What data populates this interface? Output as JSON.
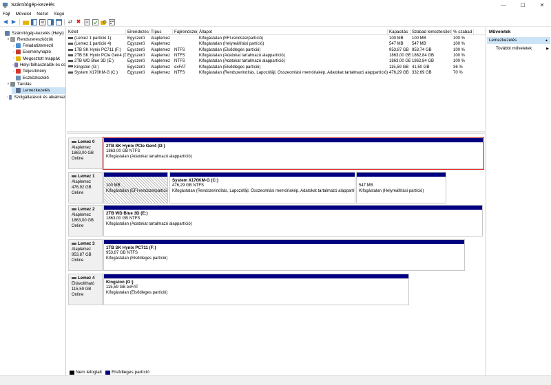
{
  "window": {
    "title": "Számítógép-kezelés"
  },
  "menu": [
    "Fájl",
    "Művelet",
    "Nézet",
    "Súgó"
  ],
  "tree": [
    {
      "label": "Számítógép-kezelés (Helyi)",
      "level": 0,
      "expander": "",
      "icon": "computer-icon",
      "color": "#5b7fa6"
    },
    {
      "label": "Rendszereszközök",
      "level": 1,
      "expander": "v",
      "icon": "tools-icon",
      "color": "#9a9a9a"
    },
    {
      "label": "Feladatütemező",
      "level": 2,
      "expander": ">",
      "icon": "clock-icon",
      "color": "#4a8fd0"
    },
    {
      "label": "Eseménynapló",
      "level": 2,
      "expander": ">",
      "icon": "event-log-icon",
      "color": "#c0392b"
    },
    {
      "label": "Megosztott mappák",
      "level": 2,
      "expander": ">",
      "icon": "folder-icon",
      "color": "#e6b400"
    },
    {
      "label": "Helyi felhasználók és cs",
      "level": 2,
      "expander": ">",
      "icon": "users-icon",
      "color": "#7a6fb3"
    },
    {
      "label": "Teljesítmény",
      "level": 2,
      "expander": ">",
      "icon": "performance-icon",
      "color": "#d9342b"
    },
    {
      "label": "Eszközkezelő",
      "level": 2,
      "expander": "",
      "icon": "device-icon",
      "color": "#6b8fb3"
    },
    {
      "label": "Tárolás",
      "level": 1,
      "expander": "v",
      "icon": "storage-icon",
      "color": "#7f8c8d"
    },
    {
      "label": "Lemezkezelés",
      "level": 2,
      "expander": "",
      "icon": "disk-icon",
      "color": "#5a6e8c",
      "selected": true
    },
    {
      "label": "Szolgáltatások és alkalmaz",
      "level": 1,
      "expander": ">",
      "icon": "services-icon",
      "color": "#6c8ebf"
    }
  ],
  "volume_table": {
    "columns": [
      "Kötet",
      "Elrendezés",
      "Típus",
      "Fájlrendszer",
      "Állapot",
      "Kapacitás",
      "Szabad lemezterület",
      "% szabad"
    ],
    "rows": [
      [
        "(Lemez 1 partíció 1)",
        "Egyszerű",
        "Alaplemez",
        "",
        "Kifogástalan (EFI-rendszerpartíció)",
        "100 MB",
        "100 MB",
        "100 %"
      ],
      [
        "(Lemez 1 partíció 4)",
        "Egyszerű",
        "Alaplemez",
        "",
        "Kifogástalan (Helyreállítási partíció)",
        "547 MB",
        "547 MB",
        "100 %"
      ],
      [
        "1TB SK Hynix PC711 (F:)",
        "Egyszerű",
        "Alaplemez",
        "NTFS",
        "Kifogástalan (Elsődleges partíció)",
        "953,87 GB",
        "953,74 GB",
        "100 %"
      ],
      [
        "2TB SK Hynix PCIe Gen4 (D:)",
        "Egyszerű",
        "Alaplemez",
        "NTFS",
        "Kifogástalan (Adatokat tartalmazó alappartíció)",
        "1863,00 GB",
        "1862,84 GB",
        "100 %"
      ],
      [
        "2TB WD Blue 3D (E:)",
        "Egyszerű",
        "Alaplemez",
        "NTFS",
        "Kifogástalan (Adatokat tartalmazó alappartíció)",
        "1863,00 GB",
        "1862,84 GB",
        "100 %"
      ],
      [
        "Kingston (G:)",
        "Egyszerű",
        "Alaplemez",
        "exFAT",
        "Kifogástalan (Elsődleges partíció)",
        "115,59 GB",
        "41,50 GB",
        "36 %"
      ],
      [
        "System X170KM-G (C:)",
        "Egyszerű",
        "Alaplemez",
        "NTFS",
        "Kifogástalan (Rendszerindítás, Lapozófájl, Összeomlási memóriakép, Adatokat tartalmazó alappartíció)",
        "476,29 GB",
        "332,69 GB",
        "70 %"
      ]
    ]
  },
  "disks": [
    {
      "name": "Lemez 0",
      "type": "Alaplemez",
      "size": "1863,00 GB",
      "status": "Online",
      "partitions": [
        {
          "name": "2TB SK Hynix PCIe Gen4  (D:)",
          "size": "1863,00 GB NTFS",
          "status": "Kifogástalan (Adatokat tartalmazó alappartíció)",
          "selected": true
        }
      ]
    },
    {
      "name": "Lemez 1",
      "type": "Alaplemez",
      "size": "476,92 GB",
      "status": "Online",
      "partitions": [
        {
          "name": "",
          "size": "100 MB",
          "status": "Kifogástalan (EFI-rendszerpartíció)",
          "hatched": true
        },
        {
          "name": "System X170KM-G  (C:)",
          "size": "476,29 GB NTFS",
          "status": "Kifogástalan (Rendszerindítás, Lapozófájl, Összeomlási memóriakép, Adatokat tartalmazó alappartíció)"
        },
        {
          "name": "",
          "size": "547 MB",
          "status": "Kifogástalan (Helyreállítási partíció)"
        }
      ]
    },
    {
      "name": "Lemez 2",
      "type": "Alaplemez",
      "size": "1863,00 GB",
      "status": "Online",
      "partitions": [
        {
          "name": "2TB WD Blue 3D  (E:)",
          "size": "1863,00 GB NTFS",
          "status": "Kifogástalan (Adatokat tartalmazó alappartíció)"
        }
      ]
    },
    {
      "name": "Lemez 3",
      "type": "Alaplemez",
      "size": "953,87 GB",
      "status": "Online",
      "partitions": [
        {
          "name": "1TB SK Hynix PC711  (F:)",
          "size": "953,87 GB NTFS",
          "status": "Kifogástalan (Elsődleges partíció)"
        }
      ]
    },
    {
      "name": "Lemez 4",
      "type": "Eltávolítható",
      "size": "115,59 GB",
      "status": "Online",
      "partitions": [
        {
          "name": "Kingston  (G:)",
          "size": "115,59 GB exFAT",
          "status": "Kifogástalan (Elsődleges partíció)"
        }
      ]
    }
  ],
  "legend": [
    {
      "label": "Nem lefoglalt",
      "color": "#000000"
    },
    {
      "label": "Elsődleges partíció",
      "color": "#000080"
    }
  ],
  "actions": {
    "header": "Műveletek",
    "section": "Lemezkezelés",
    "item": "További műveletek"
  },
  "colors": {
    "partition_bar": "#000080",
    "selection_outline": "#e03030",
    "tree_selected": "#cce4f7"
  }
}
